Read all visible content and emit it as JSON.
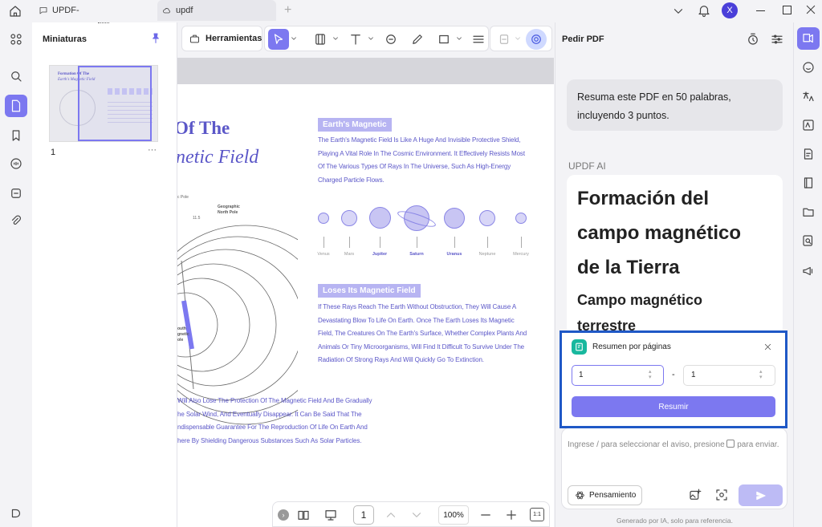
{
  "titlebar": {
    "tab1_title": "UPDF-",
    "tab2_title": "updf",
    "new_tab": "+",
    "avatar_initial": "X"
  },
  "thumbnails": {
    "title": "Miniaturas",
    "page_number": "1",
    "more": "···",
    "thumb_title_line1": "Formation Of The",
    "thumb_title_line2": "Earth's Magnetic Field"
  },
  "toolbar": {
    "tools_label": "Herramientas"
  },
  "document": {
    "title_line1": "Of The",
    "title_line2": "netic Field",
    "section1_header": "Earth's Magnetic",
    "section1_body": [
      "The Earth's Magnetic Field Is Like A Huge And Invisible Protective Shield,",
      "Playing A Vital Role In The Cosmic Environment. It Effectively Resists Most",
      "Of The Various Types Of Rays In The Universe, Such As High-Energy",
      "Charged Particle Flows."
    ],
    "planets": [
      "Venus",
      "Mars",
      "Jupiter",
      "Saturn",
      "Uranus",
      "Neptune",
      "Mercury"
    ],
    "geo_label_1": "Geographic",
    "geo_label_2": "North Pole",
    "pole_label": "c Pole",
    "angle_label": "11.5",
    "south_label_1": "outh",
    "south_label_2": "gnetic",
    "south_label_3": "ole",
    "section2_header": "Loses Its Magnetic Field",
    "section2_body": [
      "If These Rays Reach The Earth Without Obstruction, They Will Cause A",
      "Devastating Blow To Life On Earth. Once The Earth Loses Its Magnetic",
      "Field, The Creatures On The Earth's Surface, Whether Complex Plants And",
      "Animals Or Tiny Microorganisms, Will Find It Difficult To Survive Under The",
      "Radiation Of Strong Rays And Will Quickly Go To Extinction."
    ],
    "bottom_body": [
      "Will Also Lose The Protection Of The Magnetic Field And Be Gradually",
      "he Solar Wind, And Eventually Disappear. It Can Be Said That The",
      "ndispensable Guarantee For The Reproduction Of Life On Earth And",
      "here By Shielding Dangerous Substances Such As Solar Particles."
    ]
  },
  "bottombar": {
    "page_value": "1",
    "zoom": "100%",
    "fit_label": "1:1"
  },
  "ai": {
    "panel_title": "Pedir PDF",
    "user_msg_line1": "Resuma este PDF en 50 palabras,",
    "user_msg_line2": "incluyendo 3 puntos.",
    "assistant_name": "UPDF AI",
    "response_h1_line1": "Formación del",
    "response_h1_line2": "campo magnético",
    "response_h1_line3": "de la Tierra",
    "response_h2_line1": "Campo magnético",
    "response_h2_line2": "terrestre",
    "popup_title": "Resumen por páginas",
    "range_from": "1",
    "range_sep": "-",
    "range_to": "1",
    "summarize_button": "Resumir",
    "input_placeholder": "Ingrese / para seleccionar el aviso, presione",
    "input_placeholder_tail": "para enviar.",
    "thinking_label": "Pensamiento",
    "footer_note": "Generado por IA, solo para referencia."
  },
  "colors": {
    "accent": "#7c78f0",
    "highlight_border": "#1f58c6"
  }
}
